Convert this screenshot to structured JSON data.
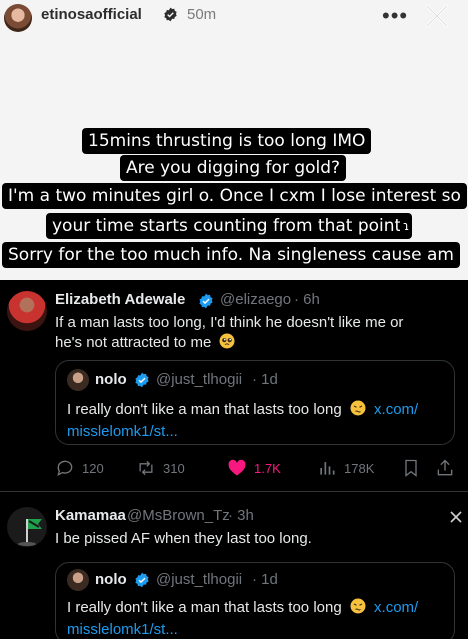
{
  "story": {
    "username": "etinosaofficial",
    "time_ago": "50m",
    "more_label": "•••",
    "caption_lines": [
      "15mins thrusting is too long IMO",
      "Are you digging for gold?",
      "I'm a two minutes girl o. Once I cxm I lose interest so",
      "your time starts counting from that point",
      "Sorry for the too much info. Na singleness cause am"
    ],
    "caption_tail": "ɿ"
  },
  "tweets": [
    {
      "name": "Elizabeth Adewale",
      "handle": "@elizaego",
      "time": "· 6h",
      "text_line1": "If a man lasts too long, I'd think he doesn't like me or",
      "text_line2": "he's not attracted to me",
      "quote": {
        "name": "nolo",
        "handle": "@just_tlhogii",
        "time": "· 1d",
        "text": "I really don't like a man that lasts too long",
        "link1": "x.com/",
        "link2": "misslelomk1/st..."
      },
      "actions": {
        "replies": "120",
        "reposts": "310",
        "likes": "1.7K",
        "views": "178K"
      }
    },
    {
      "name": "Kamamaa",
      "handle": "@MsBrown_Tz",
      "time": "· 3h",
      "text": "I be pissed AF when they last too long.",
      "quote": {
        "name": "nolo",
        "handle": "@just_tlhogii",
        "time": "· 1d",
        "text": "I really don't like a man that lasts too long",
        "link1": "x.com/",
        "link2": "misslelomk1/st..."
      }
    }
  ],
  "colors": {
    "verified_blue": "#1d9bf0",
    "like_pink": "#f91880",
    "muted": "#71767b"
  }
}
